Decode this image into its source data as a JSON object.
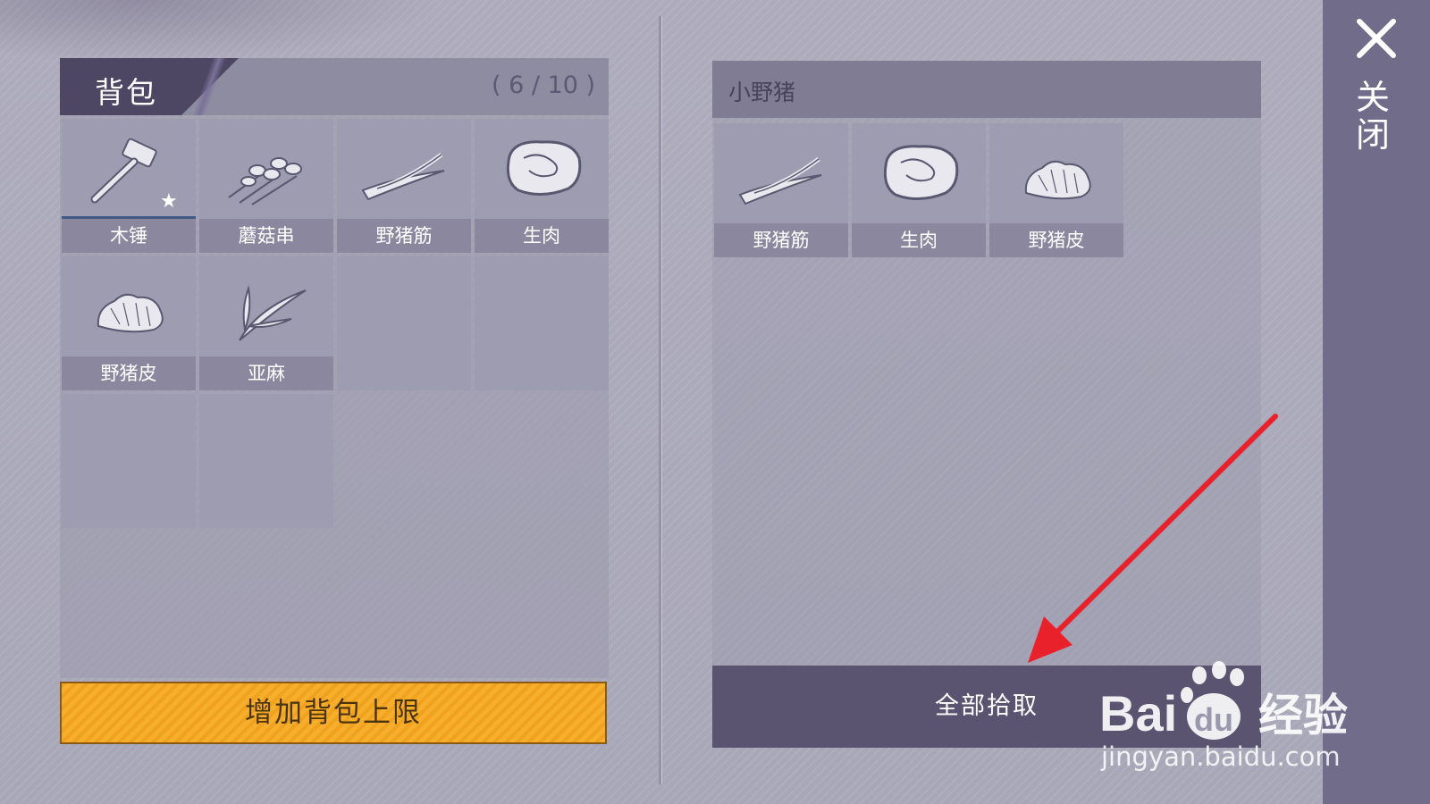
{
  "backpack": {
    "title": "背包",
    "capacity": "( 6 / 10 )",
    "items": [
      {
        "label": "木锤",
        "icon": "hammer-icon"
      },
      {
        "label": "蘑菇串",
        "icon": "mushroom-skewer-icon"
      },
      {
        "label": "野猪筋",
        "icon": "boar-tendon-icon"
      },
      {
        "label": "生肉",
        "icon": "raw-meat-icon"
      },
      {
        "label": "野猪皮",
        "icon": "boar-hide-icon"
      },
      {
        "label": "亚麻",
        "icon": "flax-icon"
      }
    ],
    "expand_label": "增加背包上限"
  },
  "loot": {
    "title": "小野猪",
    "items": [
      {
        "label": "野猪筋",
        "icon": "boar-tendon-icon"
      },
      {
        "label": "生肉",
        "icon": "raw-meat-icon"
      },
      {
        "label": "野猪皮",
        "icon": "boar-hide-icon"
      }
    ],
    "take_all_label": "全部拾取"
  },
  "sidebar": {
    "close_label": "关闭"
  },
  "watermark": {
    "brand": "Bai du 经验",
    "url": "jingyan.baidu.com"
  },
  "colors": {
    "expand_button": "#f0a21e",
    "panel_dark": "#4d4764",
    "sidebar": "#716c8a",
    "arrow": "#e8212b"
  }
}
